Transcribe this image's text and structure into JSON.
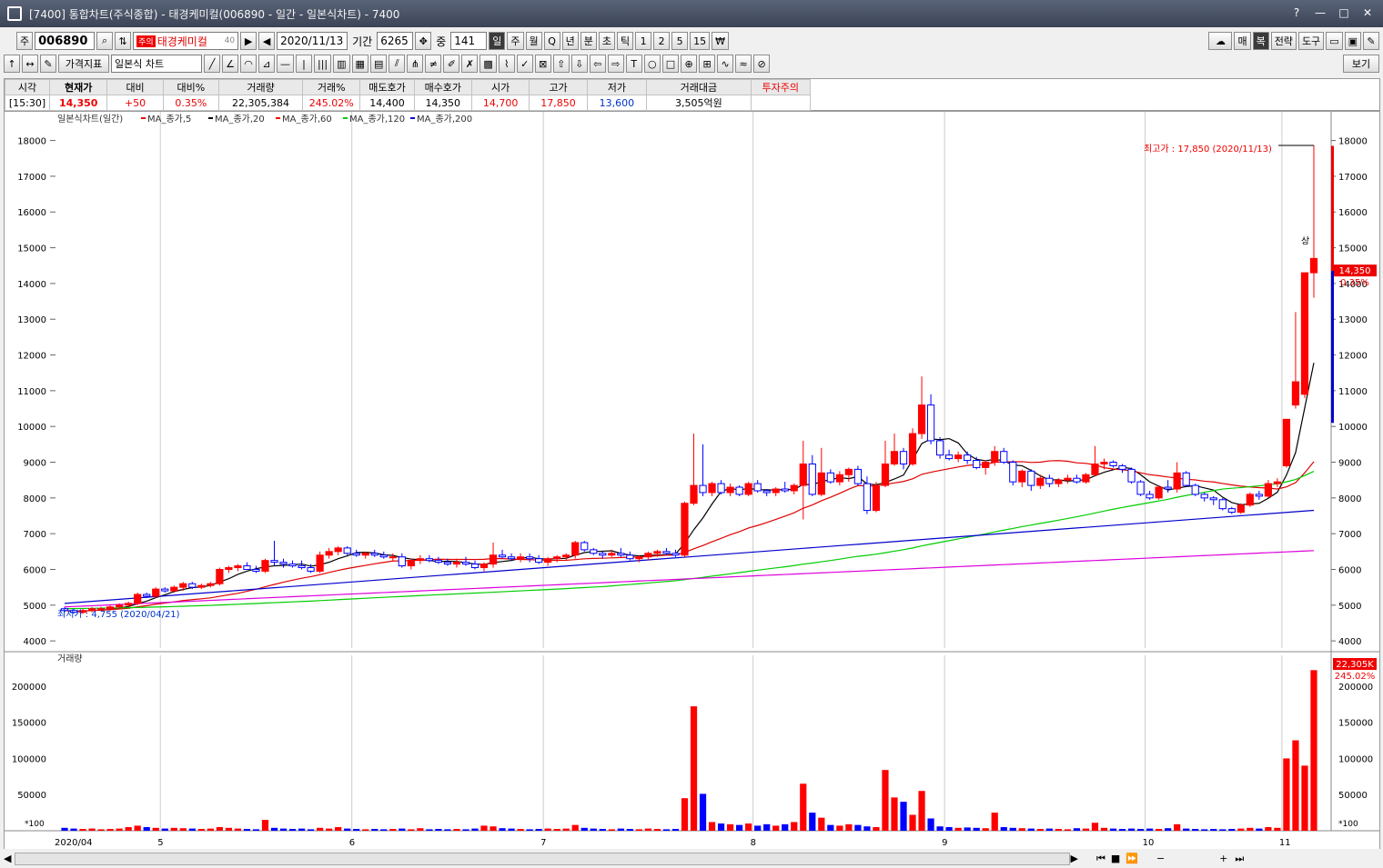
{
  "window": {
    "title": "[7400] 통합차트(주식종합) - 태경케미컬(006890 - 일간 - 일본식차트) - 7400"
  },
  "toolbar": {
    "code_prefix": "주",
    "code": "006890",
    "warn_badge": "주의",
    "stock_name": "태경케미컬",
    "name_suffix": "40",
    "date": "2020/11/13",
    "period_label": "기간",
    "period": "6265",
    "count_label": "중",
    "count": "141",
    "intervals": [
      "일",
      "주",
      "월",
      "Q",
      "년",
      "분",
      "초",
      "틱",
      "1",
      "2",
      "5",
      "15",
      "₩"
    ],
    "right_buttons": [
      "매",
      "복",
      "전략",
      "도구"
    ],
    "indicator_label": "가격지표",
    "chart_type": "일본식 차트",
    "view_label": "보기"
  },
  "quote": {
    "headers": [
      "시각",
      "현재가",
      "대비",
      "대비%",
      "거래량",
      "거래%",
      "매도호가",
      "매수호가",
      "시가",
      "고가",
      "저가",
      "거래대금",
      "투자주의"
    ],
    "values": [
      "[15:30]",
      "14,350",
      "+50",
      "0.35%",
      "22,305,384",
      "245.02%",
      "14,400",
      "14,350",
      "14,700",
      "17,850",
      "13,600",
      "3,505억원",
      ""
    ]
  },
  "chart": {
    "legend": [
      "일본식차트(일간)",
      "MA_종가,5",
      "MA_종가,20",
      "MA_종가,60",
      "MA_종가,120",
      "MA_종가,200"
    ],
    "volume_legend": "거래량",
    "high_annotation": "최고가 : 17,850 (2020/11/13)",
    "low_annotation": "최저가 : 4,755 (2020/04/21)",
    "upper_limit_mark": "상",
    "price_tag": "14,350",
    "price_pct": "0.35%",
    "volume_tag": "22,305K",
    "volume_pct": "245.02%",
    "volume_unit": "*100",
    "y_ticks": [
      "18000",
      "17000",
      "16000",
      "15000",
      "14000",
      "13000",
      "12000",
      "11000",
      "10000",
      "9000",
      "8000",
      "7000",
      "6000",
      "5000",
      "4000"
    ],
    "vol_ticks": [
      "200000",
      "150000",
      "100000",
      "50000"
    ],
    "x_labels": [
      "2020/04",
      "5",
      "6",
      "7",
      "8",
      "9",
      "10",
      "11"
    ],
    "colors": {
      "up": "#ff0000",
      "down": "#0000ff",
      "ma5": "#000000",
      "ma20": "#e00000",
      "ma60": "#00cc00",
      "ma120": "#0000cc",
      "ma200": "#dd00dd"
    }
  },
  "chart_data": {
    "type": "candlestick",
    "title": "태경케미컬(006890) 일간",
    "ylim": [
      3800,
      18600
    ],
    "volume_ylim": [
      0,
      240000
    ],
    "candles": [
      [
        4900,
        4950,
        4800,
        4850,
        4000
      ],
      [
        4850,
        4900,
        4760,
        4800,
        3000
      ],
      [
        4800,
        4900,
        4755,
        4850,
        2500
      ],
      [
        4850,
        4950,
        4800,
        4900,
        3000
      ],
      [
        4900,
        4950,
        4850,
        4900,
        2000
      ],
      [
        4900,
        5000,
        4850,
        4950,
        2500
      ],
      [
        4950,
        5050,
        4900,
        5000,
        3000
      ],
      [
        5000,
        5100,
        4950,
        5050,
        5000
      ],
      [
        5050,
        5350,
        5000,
        5300,
        7000
      ],
      [
        5300,
        5350,
        5200,
        5250,
        5000
      ],
      [
        5250,
        5500,
        5200,
        5450,
        4000
      ],
      [
        5450,
        5500,
        5350,
        5400,
        3000
      ],
      [
        5400,
        5550,
        5350,
        5500,
        4000
      ],
      [
        5500,
        5650,
        5400,
        5600,
        3500
      ],
      [
        5600,
        5650,
        5450,
        5500,
        3000
      ],
      [
        5500,
        5600,
        5450,
        5550,
        2500
      ],
      [
        5550,
        5650,
        5500,
        5600,
        3000
      ],
      [
        5600,
        6050,
        5550,
        6000,
        5000
      ],
      [
        6000,
        6100,
        5900,
        6050,
        4000
      ],
      [
        6050,
        6150,
        5950,
        6100,
        3000
      ],
      [
        6100,
        6200,
        6000,
        6000,
        2500
      ],
      [
        6000,
        6100,
        5900,
        5950,
        2000
      ],
      [
        5950,
        6300,
        5900,
        6250,
        15000
      ],
      [
        6250,
        6800,
        6100,
        6200,
        4000
      ],
      [
        6200,
        6300,
        6050,
        6150,
        3000
      ],
      [
        6150,
        6250,
        6050,
        6100,
        2500
      ],
      [
        6100,
        6250,
        6000,
        6050,
        3000
      ],
      [
        6050,
        6150,
        5900,
        5950,
        2000
      ],
      [
        5950,
        6500,
        5900,
        6400,
        4000
      ],
      [
        6400,
        6600,
        6300,
        6500,
        3000
      ],
      [
        6500,
        6650,
        6400,
        6600,
        5000
      ],
      [
        6600,
        6650,
        6400,
        6450,
        3000
      ],
      [
        6450,
        6550,
        6350,
        6400,
        2500
      ],
      [
        6400,
        6500,
        6300,
        6450,
        2000
      ],
      [
        6450,
        6550,
        6350,
        6400,
        2500
      ],
      [
        6400,
        6500,
        6300,
        6350,
        2000
      ],
      [
        6350,
        6450,
        6250,
        6350,
        2500
      ],
      [
        6350,
        6450,
        6050,
        6100,
        3000
      ],
      [
        6100,
        6300,
        6000,
        6250,
        2000
      ],
      [
        6250,
        6400,
        6150,
        6300,
        3500
      ],
      [
        6300,
        6400,
        6200,
        6250,
        2000
      ],
      [
        6250,
        6350,
        6150,
        6200,
        2500
      ],
      [
        6200,
        6300,
        6100,
        6150,
        2000
      ],
      [
        6150,
        6300,
        6050,
        6200,
        2500
      ],
      [
        6200,
        6350,
        6100,
        6150,
        2000
      ],
      [
        6150,
        6250,
        6000,
        6050,
        3000
      ],
      [
        6050,
        6200,
        5950,
        6150,
        7000
      ],
      [
        6150,
        6750,
        6050,
        6400,
        6000
      ],
      [
        6400,
        6550,
        6300,
        6350,
        3500
      ],
      [
        6350,
        6450,
        6250,
        6300,
        3000
      ],
      [
        6300,
        6450,
        6200,
        6350,
        2500
      ],
      [
        6350,
        6450,
        6200,
        6300,
        2000
      ],
      [
        6300,
        6400,
        6150,
        6200,
        2500
      ],
      [
        6200,
        6350,
        6100,
        6300,
        3000
      ],
      [
        6300,
        6400,
        6200,
        6350,
        2500
      ],
      [
        6350,
        6450,
        6250,
        6400,
        3000
      ],
      [
        6400,
        6800,
        6300,
        6750,
        8000
      ],
      [
        6750,
        6800,
        6500,
        6550,
        4000
      ],
      [
        6550,
        6600,
        6400,
        6450,
        3000
      ],
      [
        6450,
        6500,
        6300,
        6400,
        2500
      ],
      [
        6400,
        6550,
        6350,
        6450,
        2000
      ],
      [
        6450,
        6600,
        6350,
        6400,
        3000
      ],
      [
        6400,
        6500,
        6250,
        6300,
        2500
      ],
      [
        6300,
        6400,
        6200,
        6350,
        2000
      ],
      [
        6350,
        6500,
        6250,
        6450,
        3000
      ],
      [
        6450,
        6550,
        6350,
        6500,
        2500
      ],
      [
        6500,
        6600,
        6400,
        6450,
        2000
      ],
      [
        6450,
        6550,
        6350,
        6400,
        2500
      ],
      [
        6400,
        7900,
        6350,
        7850,
        45000
      ],
      [
        7850,
        9800,
        7800,
        8350,
        172000
      ],
      [
        8350,
        9500,
        8050,
        8150,
        51000
      ],
      [
        8150,
        8450,
        8050,
        8400,
        12000
      ],
      [
        8400,
        8500,
        8100,
        8150,
        10000
      ],
      [
        8150,
        8400,
        8050,
        8300,
        9000
      ],
      [
        8300,
        8350,
        8050,
        8100,
        8000
      ],
      [
        8100,
        8450,
        8050,
        8400,
        10000
      ],
      [
        8400,
        8500,
        8150,
        8200,
        7000
      ],
      [
        8200,
        8250,
        8050,
        8150,
        9000
      ],
      [
        8150,
        8300,
        8050,
        8250,
        7000
      ],
      [
        8250,
        8450,
        8150,
        8200,
        9000
      ],
      [
        8200,
        8400,
        8100,
        8350,
        12000
      ],
      [
        8350,
        9600,
        7400,
        8950,
        65000
      ],
      [
        8950,
        9200,
        8050,
        8100,
        25000
      ],
      [
        8100,
        9400,
        8050,
        8700,
        18000
      ],
      [
        8700,
        8800,
        8400,
        8450,
        8000
      ],
      [
        8450,
        8750,
        8350,
        8650,
        7000
      ],
      [
        8650,
        8850,
        8450,
        8800,
        9000
      ],
      [
        8800,
        8900,
        8350,
        8400,
        8000
      ],
      [
        8400,
        8600,
        7550,
        7650,
        6000
      ],
      [
        7650,
        8450,
        7600,
        8350,
        5000
      ],
      [
        8350,
        9600,
        8300,
        8950,
        84000
      ],
      [
        8950,
        9800,
        8900,
        9300,
        46000
      ],
      [
        9300,
        9400,
        8800,
        8950,
        40000
      ],
      [
        8950,
        9950,
        8900,
        9800,
        22000
      ],
      [
        9800,
        11400,
        9650,
        10600,
        55000
      ],
      [
        10600,
        10900,
        9500,
        9600,
        17000
      ],
      [
        9600,
        9700,
        9100,
        9200,
        6000
      ],
      [
        9200,
        9350,
        9050,
        9100,
        5000
      ],
      [
        9100,
        9300,
        9000,
        9200,
        4000
      ],
      [
        9200,
        9300,
        8950,
        9050,
        4500
      ],
      [
        9050,
        9150,
        8800,
        8850,
        4000
      ],
      [
        8850,
        9050,
        8650,
        9000,
        3500
      ],
      [
        9000,
        9450,
        8900,
        9300,
        25000
      ],
      [
        9300,
        9400,
        8950,
        9000,
        5000
      ],
      [
        9000,
        9050,
        8350,
        8450,
        4000
      ],
      [
        8450,
        8800,
        8300,
        8750,
        3500
      ],
      [
        8750,
        8800,
        8200,
        8350,
        3000
      ],
      [
        8350,
        8650,
        8250,
        8550,
        2500
      ],
      [
        8550,
        8650,
        8300,
        8400,
        3000
      ],
      [
        8400,
        8550,
        8300,
        8500,
        2500
      ],
      [
        8500,
        8650,
        8400,
        8550,
        2000
      ],
      [
        8550,
        8650,
        8400,
        8450,
        3500
      ],
      [
        8450,
        8700,
        8400,
        8650,
        3000
      ],
      [
        8650,
        9450,
        8600,
        8950,
        11000
      ],
      [
        8950,
        9100,
        8800,
        9000,
        4000
      ],
      [
        9000,
        9050,
        8850,
        8900,
        3000
      ],
      [
        8900,
        8950,
        8700,
        8800,
        2500
      ],
      [
        8800,
        8850,
        8400,
        8450,
        3000
      ],
      [
        8450,
        8500,
        8050,
        8100,
        2500
      ],
      [
        8100,
        8200,
        7950,
        8000,
        3000
      ],
      [
        8000,
        8350,
        7950,
        8300,
        2500
      ],
      [
        8300,
        8500,
        8150,
        8250,
        3500
      ],
      [
        8250,
        9000,
        8150,
        8700,
        9000
      ],
      [
        8700,
        8750,
        8300,
        8350,
        3000
      ],
      [
        8350,
        8400,
        8050,
        8100,
        2500
      ],
      [
        8100,
        8150,
        7900,
        8000,
        2000
      ],
      [
        8000,
        8050,
        7800,
        7950,
        2500
      ],
      [
        7950,
        8000,
        7650,
        7700,
        2000
      ],
      [
        7700,
        7750,
        7550,
        7600,
        2500
      ],
      [
        7600,
        7850,
        7550,
        7800,
        3000
      ],
      [
        7800,
        8150,
        7750,
        8100,
        4000
      ],
      [
        8100,
        8200,
        7950,
        8050,
        3000
      ],
      [
        8050,
        8500,
        8000,
        8400,
        5000
      ],
      [
        8400,
        8550,
        8300,
        8450,
        4000
      ],
      [
        8900,
        10200,
        8850,
        10200,
        100000
      ],
      [
        10600,
        13200,
        10500,
        11250,
        125000
      ],
      [
        10900,
        14300,
        10800,
        14300,
        90000
      ],
      [
        14300,
        17850,
        13600,
        14700,
        222000
      ]
    ],
    "ma5_last": 11600,
    "ma20_last": 8950,
    "ma60_last": 8900,
    "ma120_last": 7800,
    "ma200_last": 6650
  }
}
